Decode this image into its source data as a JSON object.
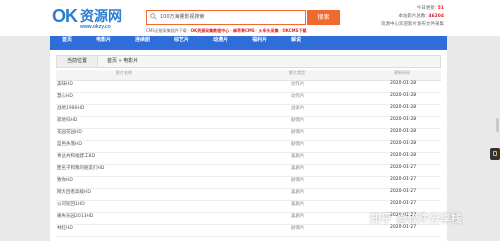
{
  "header": {
    "logo_ok": "OK",
    "logo_cn": "资源网",
    "logo_url": "www.okzy.co",
    "search_placeholder": "100万海量影视搜索",
    "search_button": "搜索",
    "links": [
      "CMS全能采集插件下载",
      "OK资源采集教程中心",
      "麻苹果CMS",
      "火车头采集",
      "OKCMS下载"
    ],
    "stats_label_1": "今日更新:",
    "stats_value_1": "51",
    "stats_label_2": "本站影片总数:",
    "stats_value_2": "46204",
    "stats_line_3": "资源中心欢迎影片发布文件采集"
  },
  "nav": {
    "items": [
      "首页",
      "电影片",
      "连续剧",
      "综艺片",
      "动漫片",
      "福利片",
      "解说"
    ]
  },
  "breadcrumb": {
    "where": "当前位置",
    "path": "首页 » 电影片"
  },
  "table": {
    "columns": [
      "影片名称",
      "影片类型",
      "更新时间"
    ],
    "rows": [
      {
        "name": "美味HD",
        "type": "动作片",
        "date": "2020-01-28"
      },
      {
        "name": "慧心HD",
        "type": "动作片",
        "date": "2020-01-28"
      },
      {
        "name": "战地1980HD",
        "type": "战争片",
        "date": "2020-01-28"
      },
      {
        "name": "寂地归HD",
        "type": "剧情片",
        "date": "2020-01-28"
      },
      {
        "name": "花园花园HD",
        "type": "剧情片",
        "date": "2020-01-28"
      },
      {
        "name": "蓝色失落HD",
        "type": "剧情片",
        "date": "2020-01-28"
      },
      {
        "name": "青丛共和福建工BD",
        "type": "喜剧片",
        "date": "2020-01-28"
      },
      {
        "name": "匿名子和我的朋友们HD",
        "type": "喜剧片",
        "date": "2020-01-27"
      },
      {
        "name": "致你HD",
        "type": "剧情片",
        "date": "2020-01-27"
      },
      {
        "name": "网大后者高级HD",
        "type": "喜剧片",
        "date": "2020-01-27"
      },
      {
        "name": "公司轮回1HD",
        "type": "喜剧片",
        "date": "2020-01-27"
      },
      {
        "name": "痛失乐园2013HD",
        "type": "喜剧片",
        "date": "2020-01-27"
      },
      {
        "name": "林红HD",
        "type": "剧情片",
        "date": "2020-01-27"
      }
    ]
  },
  "watermark": "知乎 @软件分享栈"
}
